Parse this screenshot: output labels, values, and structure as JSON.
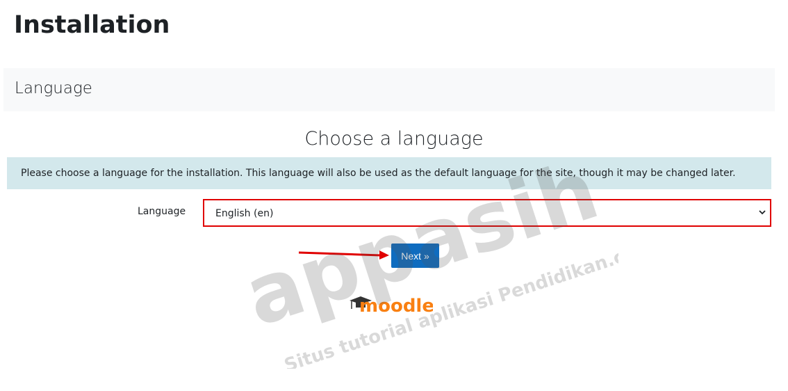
{
  "page": {
    "title": "Installation"
  },
  "section": {
    "title": "Language"
  },
  "main": {
    "heading": "Choose a language",
    "info": "Please choose a language for the installation. This language will also be used as the default language for the site, though it may be changed later.",
    "form": {
      "label": "Language",
      "selected": "English (en)"
    },
    "next_label": "Next »"
  },
  "logo": {
    "text": "moodle",
    "icon": "mortarboard-icon"
  },
  "watermark": {
    "brand": "appasih",
    "tagline": "Situs tutorial aplikasi Pendidikan.com"
  },
  "colors": {
    "primary": "#0f6cbf",
    "info_bg": "#d3e8ec",
    "highlight": "#e00000",
    "logo_orange": "#f98012"
  }
}
